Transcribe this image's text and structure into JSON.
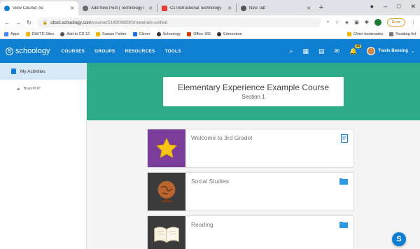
{
  "browser": {
    "tabs": [
      {
        "title": "View Course: Ac",
        "favicon_color": "#0e7fd1",
        "active": true
      },
      {
        "title": "Add New Post | Technology I",
        "favicon_color": "#6b6b6b",
        "active": false
      },
      {
        "title": "Cs Instructional Technology",
        "favicon_color": "#e53935",
        "active": false
      },
      {
        "title": "New Tab",
        "favicon_color": "#555555",
        "active": false
      }
    ],
    "new_tab": "+",
    "window_controls": [
      "–",
      "□",
      "✕"
    ],
    "url_host": "cbsd.schoology.com",
    "url_path": "/course/5169096830/materials-unified",
    "error_label": "Error",
    "bookmarks": [
      {
        "label": "Apps",
        "color": "#4285f4"
      },
      {
        "label": "DW/TC Sites",
        "color": "#f4b400"
      },
      {
        "label": "Add to CS 12",
        "color": "#555555"
      },
      {
        "label": "Sampo Folder",
        "color": "#f4b400"
      },
      {
        "label": "Clever",
        "color": "#1a73e8"
      },
      {
        "label": "Schoology",
        "color": "#333333"
      },
      {
        "label": "Office 365",
        "color": "#d83b01"
      },
      {
        "label": "Edmentum",
        "color": "#333333"
      }
    ],
    "bookmarks_right": [
      "Other bookmarks",
      "Reading list"
    ]
  },
  "header": {
    "logo": "schoology",
    "nav": [
      "COURSES",
      "GROUPS",
      "RESOURCES",
      "TOOLS"
    ],
    "notification_count": "10",
    "user_name": "Travis Bensing",
    "color": "#0e7fd1"
  },
  "sidebar": {
    "active_item": "My Activities",
    "items": [
      "BrainPOP"
    ]
  },
  "course": {
    "title": "Elementary Experience Example Course",
    "section": "Section 1",
    "banner_color": "#2eac8a"
  },
  "materials": [
    {
      "name": "Welcome to 3rd Grade!",
      "thumb_bg": "#7b3d9a",
      "icon": "star-icon",
      "type_icon": "page-icon"
    },
    {
      "name": "Social Studies",
      "thumb_bg": "#3b3b3b",
      "icon": "globe-icon",
      "type_icon": "folder-icon"
    },
    {
      "name": "Reading",
      "thumb_bg": "#3b3b3b",
      "icon": "book-icon",
      "type_icon": "folder-icon"
    }
  ],
  "fab_label": "S"
}
